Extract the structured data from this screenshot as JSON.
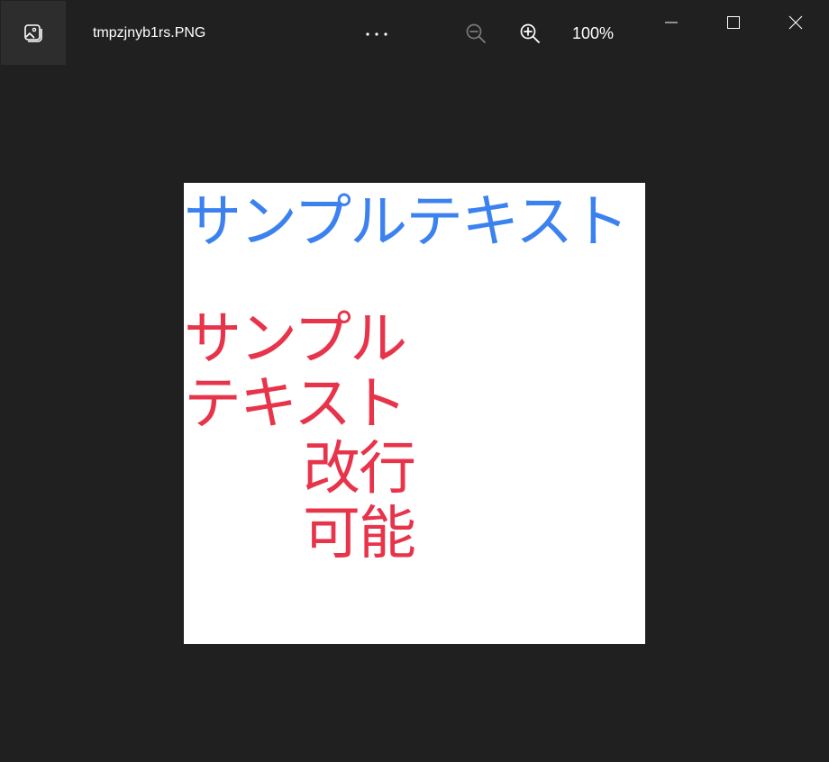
{
  "titlebar": {
    "filename": "tmpzjnyb1rs.PNG",
    "more_label": "• • •",
    "zoom_level": "100%"
  },
  "icons": {
    "app": "photos-app-icon",
    "more": "more-options-icon",
    "zoom_out": "zoom-out-icon",
    "zoom_in": "zoom-in-icon",
    "minimize": "minimize-icon",
    "maximize": "maximize-icon",
    "close": "close-icon"
  },
  "image": {
    "line1": "サンプルテキスト",
    "wrapped_lines": [
      "サンプル",
      "テキスト",
      "改行",
      "可能"
    ],
    "colors": {
      "blue": "#3b82f0",
      "red": "#e8344a",
      "background": "#ffffff"
    }
  },
  "colors": {
    "window_background": "#202020",
    "titlebar_button": "#2d2d2d",
    "text": "#ffffff",
    "disabled_icon": "#7a7a7a"
  }
}
